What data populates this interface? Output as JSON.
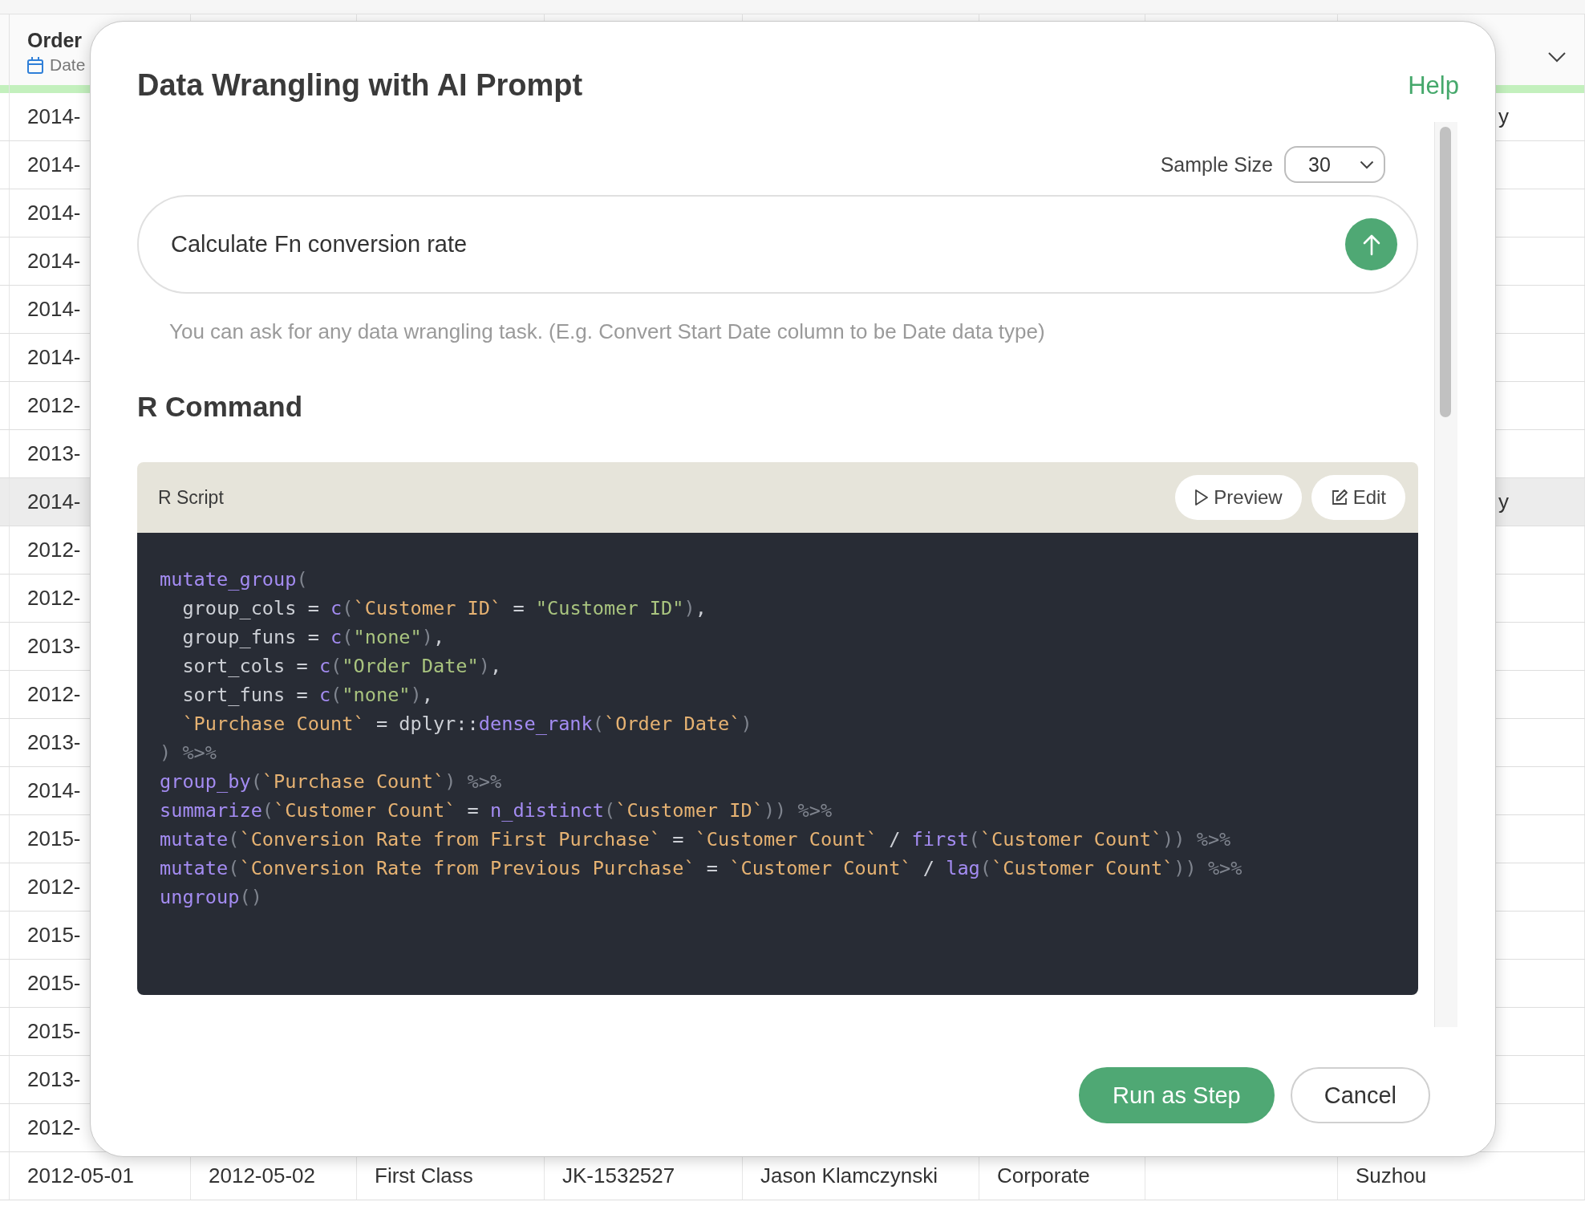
{
  "table": {
    "header": {
      "title": "Order",
      "type": "Date"
    },
    "rows": [
      {
        "cells": [
          "2014-"
        ],
        "end_cell": "y",
        "selected": false
      },
      {
        "cells": [
          "2014-"
        ],
        "selected": false
      },
      {
        "cells": [
          "2014-"
        ],
        "selected": false
      },
      {
        "cells": [
          "2014-"
        ],
        "selected": false
      },
      {
        "cells": [
          "2014-"
        ],
        "selected": false
      },
      {
        "cells": [
          "2014-"
        ],
        "selected": false
      },
      {
        "cells": [
          "2012-"
        ],
        "selected": false
      },
      {
        "cells": [
          "2013-"
        ],
        "selected": false
      },
      {
        "cells": [
          "2014-"
        ],
        "end_cell": "y",
        "selected": true
      },
      {
        "cells": [
          "2012-"
        ],
        "selected": false
      },
      {
        "cells": [
          "2012-"
        ],
        "selected": false
      },
      {
        "cells": [
          "2013-"
        ],
        "selected": false
      },
      {
        "cells": [
          "2012-"
        ],
        "selected": false
      },
      {
        "cells": [
          "2013-"
        ],
        "selected": false
      },
      {
        "cells": [
          "2014-"
        ],
        "selected": false
      },
      {
        "cells": [
          "2015-"
        ],
        "selected": false
      },
      {
        "cells": [
          "2012-"
        ],
        "selected": false
      },
      {
        "cells": [
          "2015-"
        ],
        "selected": false
      },
      {
        "cells": [
          "2015-"
        ],
        "selected": false
      },
      {
        "cells": [
          "2015-"
        ],
        "selected": false
      },
      {
        "cells": [
          "2013-"
        ],
        "selected": false
      },
      {
        "cells": [
          "2012-"
        ],
        "selected": false
      },
      {
        "cells": [
          "2012-05-01",
          "2012-05-02",
          "First Class",
          "JK-1532527",
          "Jason Klamczynski",
          "Corporate"
        ],
        "end_cell": "Suzhou",
        "selected": false
      }
    ]
  },
  "dialog": {
    "title": "Data Wrangling with AI Prompt",
    "help": "Help",
    "sample_size": {
      "label": "Sample Size",
      "value": "30"
    },
    "prompt": {
      "value": "Calculate Fn conversion rate"
    },
    "hint": "You can ask for any data wrangling task. (E.g. Convert Start Date column to be Date data type)",
    "section_title": "R Command",
    "script": {
      "title": "R Script",
      "buttons": [
        "Preview",
        "Edit"
      ],
      "lines": [
        {
          "indented": false,
          "tokens": [
            {
              "kind": "function",
              "t": "mutate_group"
            },
            {
              "kind": "punct",
              "t": "("
            }
          ]
        },
        {
          "indented": true,
          "tokens": [
            {
              "kind": "plain",
              "t": "group_cols = "
            },
            {
              "kind": "function",
              "t": "c"
            },
            {
              "kind": "punct",
              "t": "("
            },
            {
              "kind": "name",
              "t": "`Customer ID`"
            },
            {
              "kind": "plain",
              "t": " = "
            },
            {
              "kind": "string",
              "t": "\"Customer ID\""
            },
            {
              "kind": "punct",
              "t": ")"
            },
            {
              "kind": "plain",
              "t": ","
            }
          ]
        },
        {
          "indented": true,
          "tokens": [
            {
              "kind": "plain",
              "t": "group_funs = "
            },
            {
              "kind": "function",
              "t": "c"
            },
            {
              "kind": "punct",
              "t": "("
            },
            {
              "kind": "string",
              "t": "\"none\""
            },
            {
              "kind": "punct",
              "t": ")"
            },
            {
              "kind": "plain",
              "t": ","
            }
          ]
        },
        {
          "indented": true,
          "tokens": [
            {
              "kind": "plain",
              "t": "sort_cols = "
            },
            {
              "kind": "function",
              "t": "c"
            },
            {
              "kind": "punct",
              "t": "("
            },
            {
              "kind": "string",
              "t": "\"Order Date\""
            },
            {
              "kind": "punct",
              "t": ")"
            },
            {
              "kind": "plain",
              "t": ","
            }
          ]
        },
        {
          "indented": true,
          "tokens": [
            {
              "kind": "plain",
              "t": "sort_funs = "
            },
            {
              "kind": "function",
              "t": "c"
            },
            {
              "kind": "punct",
              "t": "("
            },
            {
              "kind": "string",
              "t": "\"none\""
            },
            {
              "kind": "punct",
              "t": ")"
            },
            {
              "kind": "plain",
              "t": ","
            }
          ]
        },
        {
          "indented": true,
          "tokens": [
            {
              "kind": "name",
              "t": "`Purchase Count`"
            },
            {
              "kind": "plain",
              "t": " = dplyr::"
            },
            {
              "kind": "function",
              "t": "dense_rank"
            },
            {
              "kind": "punct",
              "t": "("
            },
            {
              "kind": "name",
              "t": "`Order Date`"
            },
            {
              "kind": "punct",
              "t": ")"
            }
          ]
        },
        {
          "indented": false,
          "tokens": [
            {
              "kind": "punct",
              "t": ") %>%"
            }
          ]
        },
        {
          "indented": false,
          "tokens": [
            {
              "kind": "function",
              "t": "group_by"
            },
            {
              "kind": "punct",
              "t": "("
            },
            {
              "kind": "name",
              "t": "`Purchase Count`"
            },
            {
              "kind": "punct",
              "t": ") %>%"
            }
          ]
        },
        {
          "indented": false,
          "tokens": [
            {
              "kind": "function",
              "t": "summarize"
            },
            {
              "kind": "punct",
              "t": "("
            },
            {
              "kind": "name",
              "t": "`Customer Count`"
            },
            {
              "kind": "plain",
              "t": " = "
            },
            {
              "kind": "function",
              "t": "n_distinct"
            },
            {
              "kind": "punct",
              "t": "("
            },
            {
              "kind": "name",
              "t": "`Customer ID`"
            },
            {
              "kind": "punct",
              "t": ")) %>%"
            }
          ]
        },
        {
          "indented": false,
          "tokens": [
            {
              "kind": "function",
              "t": "mutate"
            },
            {
              "kind": "punct",
              "t": "("
            },
            {
              "kind": "name",
              "t": "`Conversion Rate from First Purchase`"
            },
            {
              "kind": "plain",
              "t": " = "
            },
            {
              "kind": "name",
              "t": "`Customer Count`"
            },
            {
              "kind": "plain",
              "t": " / "
            },
            {
              "kind": "function",
              "t": "first"
            },
            {
              "kind": "punct",
              "t": "("
            },
            {
              "kind": "name",
              "t": "`Customer Count`"
            },
            {
              "kind": "punct",
              "t": ")) %>%"
            }
          ]
        },
        {
          "indented": false,
          "tokens": [
            {
              "kind": "function",
              "t": "mutate"
            },
            {
              "kind": "punct",
              "t": "("
            },
            {
              "kind": "name",
              "t": "`Conversion Rate from Previous Purchase`"
            },
            {
              "kind": "plain",
              "t": " = "
            },
            {
              "kind": "name",
              "t": "`Customer Count`"
            },
            {
              "kind": "plain",
              "t": " / "
            },
            {
              "kind": "function",
              "t": "lag"
            },
            {
              "kind": "punct",
              "t": "("
            },
            {
              "kind": "name",
              "t": "`Customer Count`"
            },
            {
              "kind": "punct",
              "t": ")) %>%"
            }
          ]
        },
        {
          "indented": false,
          "tokens": [
            {
              "kind": "function",
              "t": "ungroup"
            },
            {
              "kind": "punct",
              "t": "()"
            }
          ]
        }
      ]
    },
    "buttons": [
      "Run as Step",
      "Cancel"
    ]
  }
}
